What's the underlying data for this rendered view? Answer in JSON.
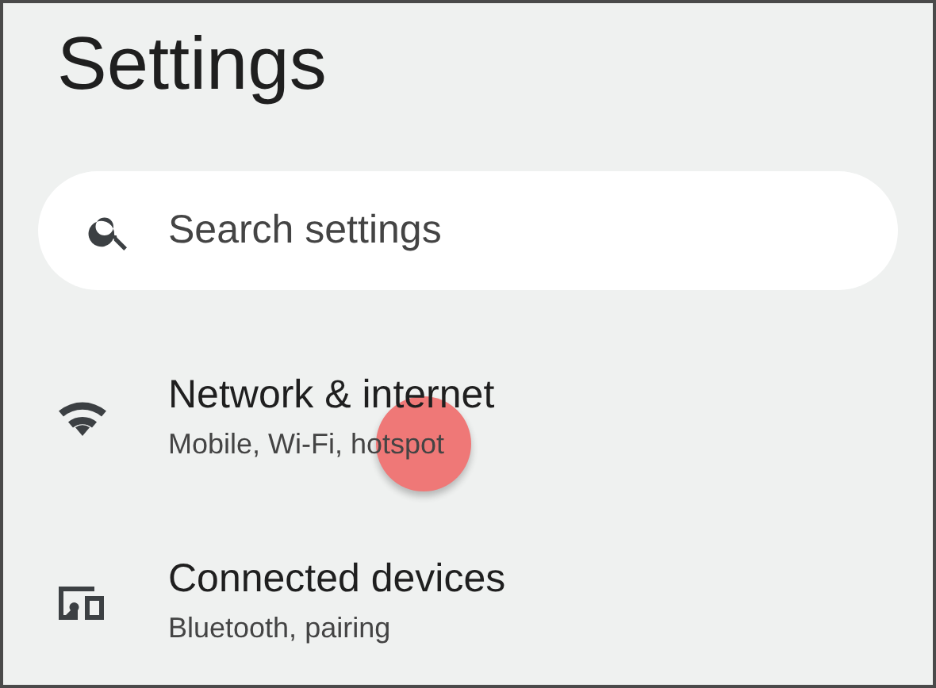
{
  "title": "Settings",
  "search": {
    "placeholder": "Search settings"
  },
  "items": [
    {
      "kind": "wifi",
      "title": "Network & internet",
      "subtitle": "Mobile, Wi-Fi, hotspot"
    },
    {
      "kind": "devices",
      "title": "Connected devices",
      "subtitle": "Bluetooth, pairing"
    }
  ]
}
